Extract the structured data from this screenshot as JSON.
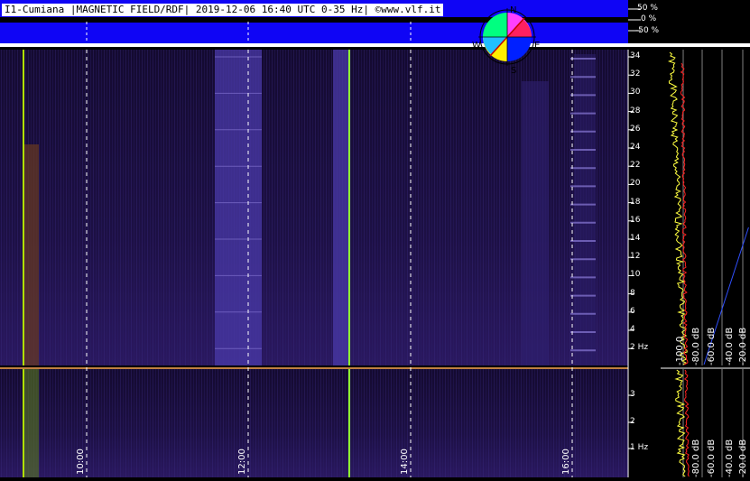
{
  "header": {
    "title": "I1-Cumiana |MAGNETIC FIELD/RDF| 2019-12-06 16:40 UTC 0-35 Hz| ©www.vlf.it"
  },
  "compass": {
    "north": "N",
    "south": "S",
    "east": "E",
    "west": "W"
  },
  "direction_scale": {
    "labels": [
      "50 %",
      "0 %",
      "-50 %"
    ]
  },
  "freq_axis_upper": {
    "labels": [
      "34",
      "32",
      "30",
      "28",
      "26",
      "24",
      "22",
      "20",
      "18",
      "16",
      "14",
      "12",
      "10",
      "8",
      "6",
      "4",
      "2 Hz"
    ]
  },
  "freq_axis_lower": {
    "labels": [
      "3",
      "2",
      "1 Hz"
    ]
  },
  "time_axis": {
    "labels": [
      "10:00",
      "12:00",
      "14:00",
      "16:00"
    ]
  },
  "db_axis_upper": {
    "labels": [
      "-100.0",
      "-80.0 dB",
      "-60.0 dB",
      "-40.0 dB",
      "-20.0 dB"
    ]
  },
  "db_axis_lower": {
    "labels": [
      "-80.0 dB",
      "-60.0 dB",
      "-40.0 dB",
      "-20.0 dB"
    ]
  },
  "colors": {
    "blue_band": "#0f05f5",
    "spectrogram_bg": "#160a34",
    "yellow_trace": "#ffff40",
    "red_trace": "#ff2020"
  }
}
